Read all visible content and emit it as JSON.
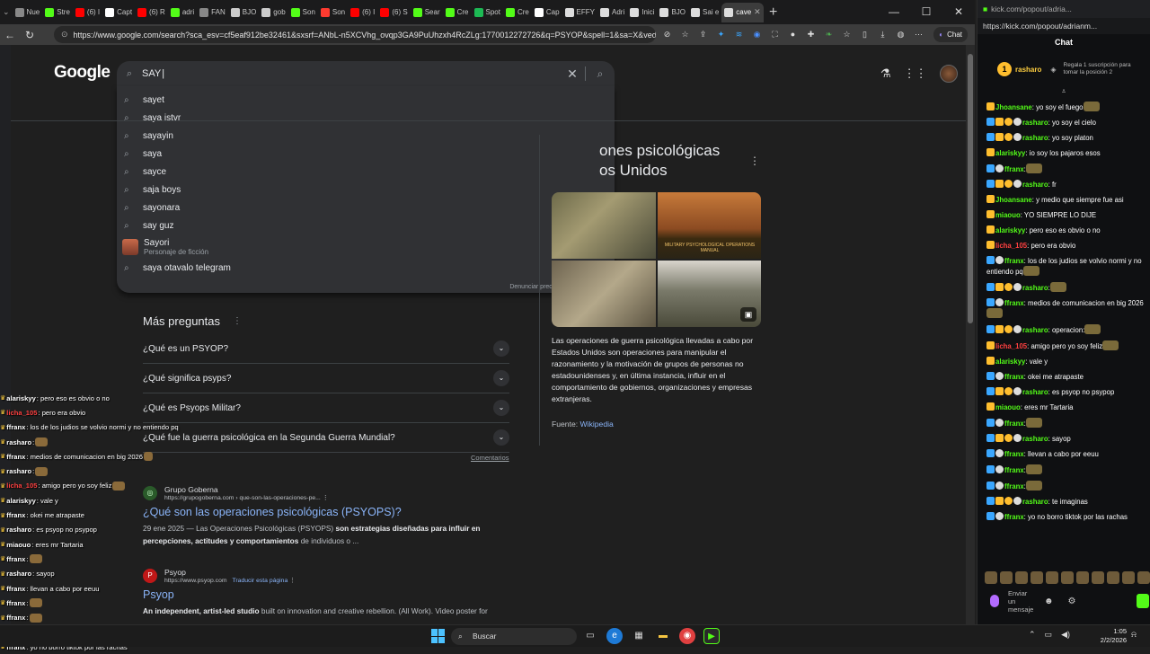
{
  "browser": {
    "tabs": [
      {
        "label": "Nue",
        "color": "#888888"
      },
      {
        "label": "Stre",
        "color": "#53fc18"
      },
      {
        "label": "(6) I",
        "color": "#ff0000"
      },
      {
        "label": "Capt",
        "color": "#ffffff"
      },
      {
        "label": "(6) R",
        "color": "#ff0000"
      },
      {
        "label": "adri",
        "color": "#53fc18"
      },
      {
        "label": "FAN",
        "color": "#888888"
      },
      {
        "label": "BJO",
        "color": "#cccccc"
      },
      {
        "label": "gob",
        "color": "#cccccc"
      },
      {
        "label": "Son",
        "color": "#53fc18"
      },
      {
        "label": "Son",
        "color": "#ff3b30"
      },
      {
        "label": "(6) I",
        "color": "#ff0000"
      },
      {
        "label": "(6) S",
        "color": "#ff0000"
      },
      {
        "label": "Sear",
        "color": "#53fc18"
      },
      {
        "label": "Cre",
        "color": "#53fc18"
      },
      {
        "label": "Spot",
        "color": "#1db954"
      },
      {
        "label": "Cre",
        "color": "#53fc18"
      },
      {
        "label": "Cap",
        "color": "#ffffff"
      },
      {
        "label": "EFFY",
        "color": "#dddddd"
      },
      {
        "label": "Adri",
        "color": "#dddddd"
      },
      {
        "label": "Inici",
        "color": "#dddddd"
      },
      {
        "label": "BJO",
        "color": "#dddddd"
      },
      {
        "label": "Sai e",
        "color": "#dddddd"
      },
      {
        "label": "cave",
        "color": "#dddddd"
      }
    ],
    "active_tab": "(6) I",
    "url": "https://www.google.com/search?sca_esv=cf5eaf912be32461&sxsrf=ANbL-n5XCVhg_ovqp3GA9PuUhzxh4RcZLg:1770012272726&q=PSYOP&spell=1&sa=X&ved=2ah...",
    "chat_label": "Chat"
  },
  "google": {
    "logo": "Google",
    "query": "SAY",
    "suggestions": [
      "sayet",
      "saya istvr",
      "sayayin",
      "saya",
      "sayce",
      "saja boys",
      "sayonara",
      "say guz"
    ],
    "person_name": "Sayori",
    "person_sub": "Personaje de ficción",
    "last_suggestion": "saya otavalo telegram",
    "report": "Denunciar predicciones ofensivas",
    "kp_title_line1": "ones psicológicas",
    "kp_title_line2": "os Unidos",
    "kp_image_caption": "MILITARY PSYCHOLOGICAL OPERATIONS MANUAL",
    "kp_description": "Las operaciones de guerra psicológica llevadas a cabo por Estados Unidos son operaciones para manipular el razonamiento y la motivación de grupos de personas no estadounidenses y, en última instancia, influir en el comportamiento de gobiernos, organizaciones y empresas extranjeras.",
    "kp_source_label": "Fuente:",
    "kp_source_link": "Wikipedia",
    "more_questions_title": "Más preguntas",
    "questions": [
      "¿Qué es un PSYOP?",
      "¿Qué significa psyps?",
      "¿Qué es Psyops Militar?",
      "¿Qué fue la guerra psicológica en la Segunda Guerra Mundial?"
    ],
    "feedback": "Comentarios",
    "results": [
      {
        "site": "Grupo Goberna",
        "url": "https://grupogoberna.com › que-son-las-operaciones-pe...",
        "title": "¿Qué son las operaciones psicológicas (PSYOPS)?",
        "date": "29 ene 2025 —",
        "snippet_a": "Las Operaciones Psicológicas (PSYOPS)",
        "snippet_b": "son estrategias diseñadas para influir en percepciones, actitudes y comportamientos",
        "snippet_c": "de individuos o ..."
      },
      {
        "site": "Psyop",
        "url": "https://www.psyop.com",
        "translate": "Traducir esta página",
        "title": "Psyop",
        "snippet_b": "An independent, artist-led studio",
        "snippet_c": "built on innovation and creative rebellion. (All Work). Video poster for"
      }
    ]
  },
  "overlay_chat": [
    {
      "user": "alariskyy",
      "text": ": pero eso es obvio o no",
      "color": "#ffffff"
    },
    {
      "user": "licha_105",
      "text": ": pero era obvio",
      "color": "#ff4040"
    },
    {
      "user": "ffranx",
      "text": ": los de los judios se volvio normi y no entiendo pq",
      "color": "#ffffff"
    },
    {
      "user": "rasharo",
      "text": ":",
      "color": "#ffffff"
    },
    {
      "user": "ffranx",
      "text": ": medios de comunicacion en big 2026",
      "color": "#ffffff"
    },
    {
      "user": "rasharo",
      "text": ":",
      "color": "#ffffff"
    },
    {
      "user": "licha_105",
      "text": ": amigo pero yo soy feliz",
      "color": "#ff4040"
    },
    {
      "user": "alariskyy",
      "text": ": vale y",
      "color": "#ffffff"
    },
    {
      "user": "ffranx",
      "text": ": okei me atrapaste",
      "color": "#ffffff"
    },
    {
      "user": "rasharo",
      "text": ": es psyop no psypop",
      "color": "#ffffff"
    },
    {
      "user": "miaouo",
      "text": ": eres mr Tartaria",
      "color": "#ffffff"
    },
    {
      "user": "ffranx",
      "text": ":",
      "color": "#ffffff"
    },
    {
      "user": "rasharo",
      "text": ": sayop",
      "color": "#ffffff"
    },
    {
      "user": "ffranx",
      "text": ": llevan a cabo por eeuu",
      "color": "#ffffff"
    },
    {
      "user": "ffranx",
      "text": ":",
      "color": "#ffffff"
    },
    {
      "user": "ffranx",
      "text": ":",
      "color": "#ffffff"
    },
    {
      "user": "rasharo",
      "text": ": te imaginas",
      "color": "#ffffff"
    },
    {
      "user": "ffranx",
      "text": ": yo no borro tiktok por las rachas",
      "color": "#ffffff"
    }
  ],
  "kick": {
    "title": "kick.com/popout/adria...",
    "url": "https://kick.com/popout/adrianm...",
    "header": "Chat",
    "sub_number": "1",
    "sub_user": "rasharo",
    "sub_text": "Regala 1 suscripción para tomar la posición 2",
    "messages": [
      {
        "user": "Jhoansane",
        "text": ": yo soy el fuego",
        "color": "#53fc18"
      },
      {
        "user": "rasharo",
        "text": ": yo soy el cielo",
        "color": "#53fc18"
      },
      {
        "user": "rasharo",
        "text": ": yo soy platon",
        "color": "#53fc18"
      },
      {
        "user": "alariskyy",
        "text": ": io soy los pajaros esos",
        "color": "#53fc18"
      },
      {
        "user": "ffranx",
        "text": ":",
        "color": "#53fc18"
      },
      {
        "user": "rasharo",
        "text": ": fr",
        "color": "#53fc18"
      },
      {
        "user": "Jhoansane",
        "text": ": y medio que siempre fue asi",
        "color": "#53fc18"
      },
      {
        "user": "miaouo",
        "text": ": YO SIEMPRE LO DIJE",
        "color": "#53fc18"
      },
      {
        "user": "alariskyy",
        "text": ": pero eso es obvio o no",
        "color": "#53fc18"
      },
      {
        "user": "licha_105",
        "text": ": pero era obvio",
        "color": "#ff4040"
      },
      {
        "user": "ffranx",
        "text": ": los de los judios se volvio normi y no entiendo pq",
        "color": "#53fc18"
      },
      {
        "user": "rasharo",
        "text": ":",
        "color": "#53fc18"
      },
      {
        "user": "ffranx",
        "text": ": medios de comunicacion en big 2026",
        "color": "#53fc18"
      },
      {
        "user": "rasharo",
        "text": ": operacion:",
        "color": "#53fc18"
      },
      {
        "user": "licha_105",
        "text": ": amigo pero yo soy feliz",
        "color": "#ff4040"
      },
      {
        "user": "alariskyy",
        "text": ": vale y",
        "color": "#53fc18"
      },
      {
        "user": "ffranx",
        "text": ": okei me atrapaste",
        "color": "#53fc18"
      },
      {
        "user": "rasharo",
        "text": ": es psyop no psypop",
        "color": "#53fc18"
      },
      {
        "user": "miaouo",
        "text": ": eres mr Tartaria",
        "color": "#53fc18"
      },
      {
        "user": "ffranx",
        "text": ":",
        "color": "#53fc18"
      },
      {
        "user": "rasharo",
        "text": ": sayop",
        "color": "#53fc18"
      },
      {
        "user": "ffranx",
        "text": ": llevan a cabo por eeuu",
        "color": "#53fc18"
      },
      {
        "user": "ffranx",
        "text": ":",
        "color": "#53fc18"
      },
      {
        "user": "ffranx",
        "text": ":",
        "color": "#53fc18"
      },
      {
        "user": "rasharo",
        "text": ": te imaginas",
        "color": "#53fc18"
      },
      {
        "user": "ffranx",
        "text": ": yo no borro tiktok por las rachas",
        "color": "#53fc18"
      }
    ],
    "input_placeholder": "Enviar un mensaje"
  },
  "taskbar": {
    "search": "Buscar",
    "time": "1:05",
    "date": "2/2/2026"
  }
}
